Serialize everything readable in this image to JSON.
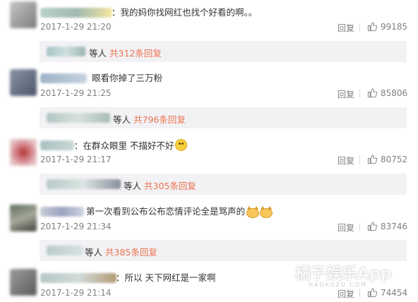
{
  "colors": {
    "link": "#eb7350",
    "meta": "#808080",
    "reply_bg": "#f2f2f5"
  },
  "icons": {
    "like": "thumbs-up-icon",
    "smile": "smile-emoji",
    "cat": "cat-emoji"
  },
  "comments": [
    {
      "text": "：我的妈你找网红也找个好看的啊。。",
      "time": "2017-1-29 21:20",
      "reply_label": "回复",
      "likes": "99185",
      "sub_people": "等人",
      "sub_link": "共312条回复"
    },
    {
      "text": "眼看你掉了三万粉",
      "time": "2017-1-29 21:25",
      "reply_label": "回复",
      "likes": "85806",
      "sub_people": "等人",
      "sub_link": "共796条回复"
    },
    {
      "text": "：在群众眼里 不描好不好",
      "time": "2017-1-29 21:17",
      "reply_label": "回复",
      "likes": "80752",
      "sub_people": "等人",
      "sub_link": "共305条回复"
    },
    {
      "text": "第一次看到公布公布恋情评论全是骂声的",
      "time": "2017-1-29 21:34",
      "reply_label": "回复",
      "likes": "83746",
      "sub_people": "等人",
      "sub_link": "共385条回复"
    },
    {
      "text": "：所以 天下网红是一家啊",
      "time": "2017-1-29 21:14",
      "reply_label": "回复",
      "likes": "74454"
    }
  ],
  "watermark": {
    "brand": "橘子娱乐App",
    "site": "HAOKUZU.COM"
  }
}
